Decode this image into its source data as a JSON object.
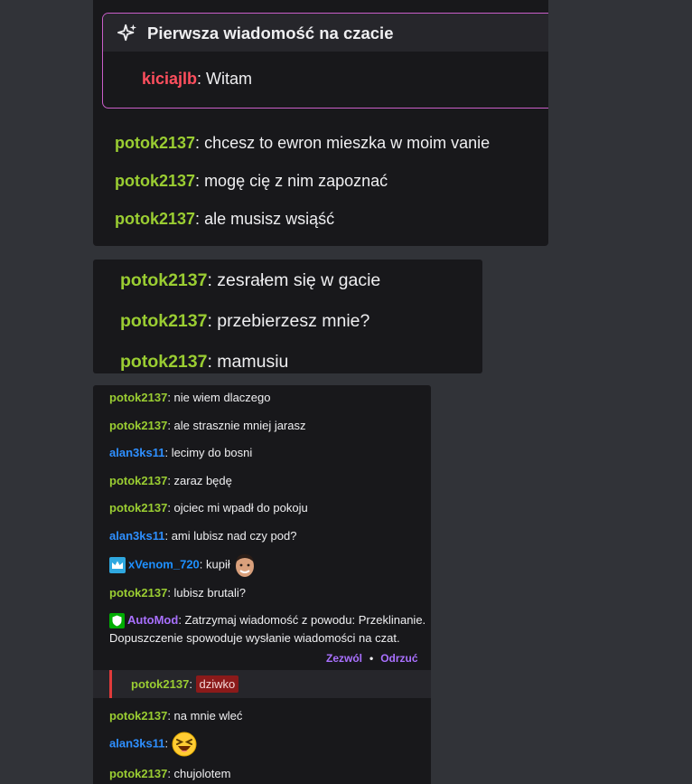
{
  "panel1": {
    "first_message_title": "Pierwsza wiadomość na czacie",
    "first_message": {
      "user": "kiciajlb",
      "text": "Witam"
    },
    "messages": [
      {
        "user": "potok2137",
        "text": "chcesz to ewron mieszka w moim vanie"
      },
      {
        "user": "potok2137",
        "text": "mogę cię z nim zapoznać"
      },
      {
        "user": "potok2137",
        "text": "ale musisz wsiąść"
      }
    ]
  },
  "panel2": {
    "messages": [
      {
        "user": "potok2137",
        "text": "zesrałem się w gacie"
      },
      {
        "user": "potok2137",
        "text": "przebierzesz mnie?"
      },
      {
        "user": "potok2137",
        "text": "mamusiu"
      }
    ]
  },
  "panel3": {
    "messages": [
      {
        "user": "potok2137",
        "text": "nie wiem dlaczego"
      },
      {
        "user": "potok2137",
        "text": "ale strasznie mniej jarasz"
      },
      {
        "user": "alan3ks11",
        "text": "lecimy do bosni"
      },
      {
        "user": "potok2137",
        "text": "zaraz będę"
      },
      {
        "user": "potok2137",
        "text": "ojciec mi wpadł do pokoju"
      },
      {
        "user": "alan3ks11",
        "text": "ami lubisz nad czy pod?"
      },
      {
        "user": "xVenom_720",
        "text": "kupił"
      },
      {
        "user": "potok2137",
        "text": "lubisz brutali?"
      }
    ],
    "automod": {
      "user": "AutoMod",
      "text": "Zatrzymaj wiadomość z powodu: Przeklinanie. Dopuszczenie spowoduje wysłanie wiadomości na czat.",
      "allow": "Zezwól",
      "deny": "Odrzuć",
      "held_user": "potok2137",
      "held_text": "dziwko"
    },
    "after": [
      {
        "user": "potok2137",
        "text": "na mnie wleć"
      },
      {
        "user": "alan3ks11",
        "text": ""
      },
      {
        "user": "potok2137",
        "text": "chujolotem"
      }
    ]
  },
  "colors": {
    "background": "#313338",
    "chat_bg": "#18181b",
    "green_user": "#9acd32",
    "blue_user": "#2e8fff",
    "automod": "#a970ff",
    "first_msg_border": "#c95ec9",
    "red_user": "#ff4f5e"
  },
  "icons": [
    "sparkle-icon",
    "camera-icon",
    "crown-badge-icon",
    "automod-shield-icon",
    "face-emote",
    "laughing-emoji"
  ]
}
